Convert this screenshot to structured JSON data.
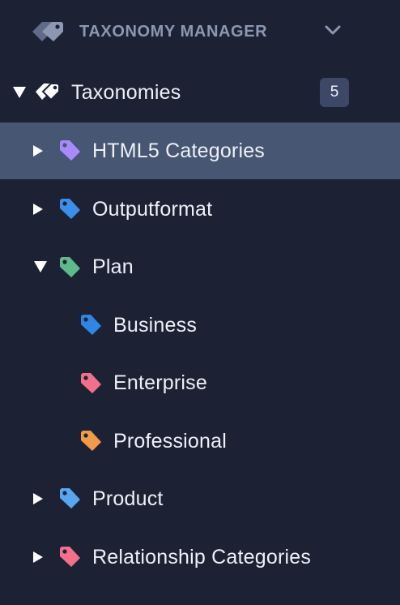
{
  "header": {
    "title": "TAXONOMY MANAGER",
    "logo_icon": "tags-icon",
    "toggle_icon": "chevron-down-icon"
  },
  "root": {
    "label": "Taxonomies",
    "count": "5",
    "expanded": true
  },
  "items": [
    {
      "label": "HTML5 Categories",
      "color": "#a78bfa",
      "expanded": false,
      "selected": true
    },
    {
      "label": "Outputformat",
      "color": "#3b8eea",
      "expanded": false
    },
    {
      "label": "Plan",
      "color": "#5fb98a",
      "expanded": true,
      "children": [
        {
          "label": "Business",
          "color": "#2f86e6"
        },
        {
          "label": "Enterprise",
          "color": "#f2708a"
        },
        {
          "label": "Professional",
          "color": "#f39a4a"
        }
      ]
    },
    {
      "label": "Product",
      "color": "#57a6ef",
      "expanded": false
    },
    {
      "label": "Relationship Categories",
      "color": "#f2708a",
      "expanded": false
    }
  ],
  "colors": {
    "background": "#1c2234",
    "selected_row": "#475672",
    "badge": "#3d4766",
    "header_text": "#8c97b1"
  }
}
